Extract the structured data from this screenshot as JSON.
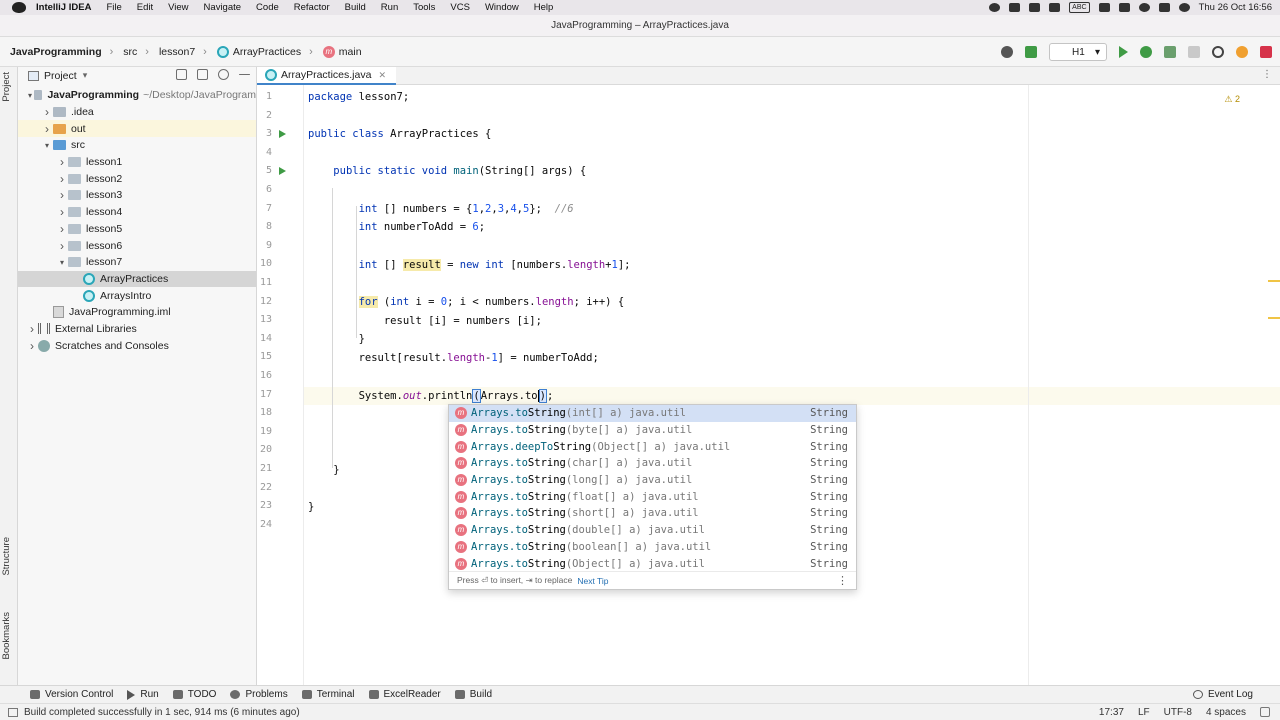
{
  "menubar": {
    "app_name": "IntelliJ IDEA",
    "items": [
      "File",
      "Edit",
      "View",
      "Navigate",
      "Code",
      "Refactor",
      "Build",
      "Run",
      "Tools",
      "VCS",
      "Window",
      "Help"
    ],
    "input_source": "ABC",
    "datetime": "Thu 26 Oct  16:56"
  },
  "window_title": "JavaProgramming – ArrayPractices.java",
  "breadcrumbs": [
    "JavaProgramming",
    "src",
    "lesson7",
    "ArrayPractices",
    "main"
  ],
  "run_config": "H1",
  "left_strip": {
    "project": "Project",
    "structure": "Structure",
    "bookmarks": "Bookmarks"
  },
  "project_panel": {
    "title": "Project",
    "tree": [
      {
        "label": "JavaProgramming",
        "path": "~/Desktop/JavaProgram",
        "indent": 0,
        "expanded": true,
        "icon": "folder"
      },
      {
        "label": ".idea",
        "indent": 1,
        "expanded": false,
        "icon": "folder"
      },
      {
        "label": "out",
        "indent": 1,
        "expanded": false,
        "icon": "folder-orange"
      },
      {
        "label": "src",
        "indent": 1,
        "expanded": true,
        "icon": "folder-blue"
      },
      {
        "label": "lesson1",
        "indent": 2,
        "expanded": false,
        "icon": "package"
      },
      {
        "label": "lesson2",
        "indent": 2,
        "expanded": false,
        "icon": "package"
      },
      {
        "label": "lesson3",
        "indent": 2,
        "expanded": false,
        "icon": "package"
      },
      {
        "label": "lesson4",
        "indent": 2,
        "expanded": false,
        "icon": "package"
      },
      {
        "label": "lesson5",
        "indent": 2,
        "expanded": false,
        "icon": "package"
      },
      {
        "label": "lesson6",
        "indent": 2,
        "expanded": false,
        "icon": "package"
      },
      {
        "label": "lesson7",
        "indent": 2,
        "expanded": true,
        "icon": "package"
      },
      {
        "label": "ArrayPractices",
        "indent": 3,
        "icon": "class",
        "selected": true
      },
      {
        "label": "ArraysIntro",
        "indent": 3,
        "icon": "class"
      },
      {
        "label": "JavaProgramming.iml",
        "indent": 1,
        "icon": "iml"
      },
      {
        "label": "External Libraries",
        "indent": 0,
        "expanded": false,
        "icon": "library"
      },
      {
        "label": "Scratches and Consoles",
        "indent": 0,
        "expanded": false,
        "icon": "scratches"
      }
    ]
  },
  "editor": {
    "tab": "ArrayPractices.java",
    "warnings": "2",
    "line_numbers": [
      "1",
      "2",
      "3",
      "4",
      "5",
      "6",
      "7",
      "8",
      "9",
      "10",
      "11",
      "12",
      "13",
      "14",
      "15",
      "16",
      "17",
      "18",
      "19",
      "20",
      "21",
      "22",
      "23",
      "24"
    ]
  },
  "completion": {
    "items": [
      {
        "owner": "Arrays.",
        "pre": "to",
        "match": "String",
        "sig": "(int[] a) java.util",
        "type": "String"
      },
      {
        "owner": "Arrays.",
        "pre": "to",
        "match": "String",
        "sig": "(byte[] a) java.util",
        "type": "String"
      },
      {
        "owner": "Arrays.",
        "pre": "deepTo",
        "match": "String",
        "sig": "(Object[] a) java.util",
        "type": "String"
      },
      {
        "owner": "Arrays.",
        "pre": "to",
        "match": "String",
        "sig": "(char[] a) java.util",
        "type": "String"
      },
      {
        "owner": "Arrays.",
        "pre": "to",
        "match": "String",
        "sig": "(long[] a) java.util",
        "type": "String"
      },
      {
        "owner": "Arrays.",
        "pre": "to",
        "match": "String",
        "sig": "(float[] a) java.util",
        "type": "String"
      },
      {
        "owner": "Arrays.",
        "pre": "to",
        "match": "String",
        "sig": "(short[] a) java.util",
        "type": "String"
      },
      {
        "owner": "Arrays.",
        "pre": "to",
        "match": "String",
        "sig": "(double[] a) java.util",
        "type": "String"
      },
      {
        "owner": "Arrays.",
        "pre": "to",
        "match": "String",
        "sig": "(boolean[] a) java.util",
        "type": "String"
      },
      {
        "owner": "Arrays.",
        "pre": "to",
        "match": "String",
        "sig": "(Object[] a) java.util",
        "type": "String"
      }
    ],
    "footer": "Press ⏎ to insert, ⇥ to replace",
    "next_tip": "Next Tip"
  },
  "bottom_tools": [
    "Version Control",
    "Run",
    "TODO",
    "Problems",
    "Terminal",
    "ExcelReader",
    "Build"
  ],
  "event_log": "Event Log",
  "status": {
    "message": "Build completed successfully in 1 sec, 914 ms (6 minutes ago)",
    "position": "17:37",
    "line_sep": "LF",
    "encoding": "UTF-8",
    "indent": "4 spaces"
  },
  "colors": {
    "accent": "#4083c9",
    "run_green": "#3f9b45",
    "keyword": "#0033b3",
    "number": "#1750eb"
  }
}
